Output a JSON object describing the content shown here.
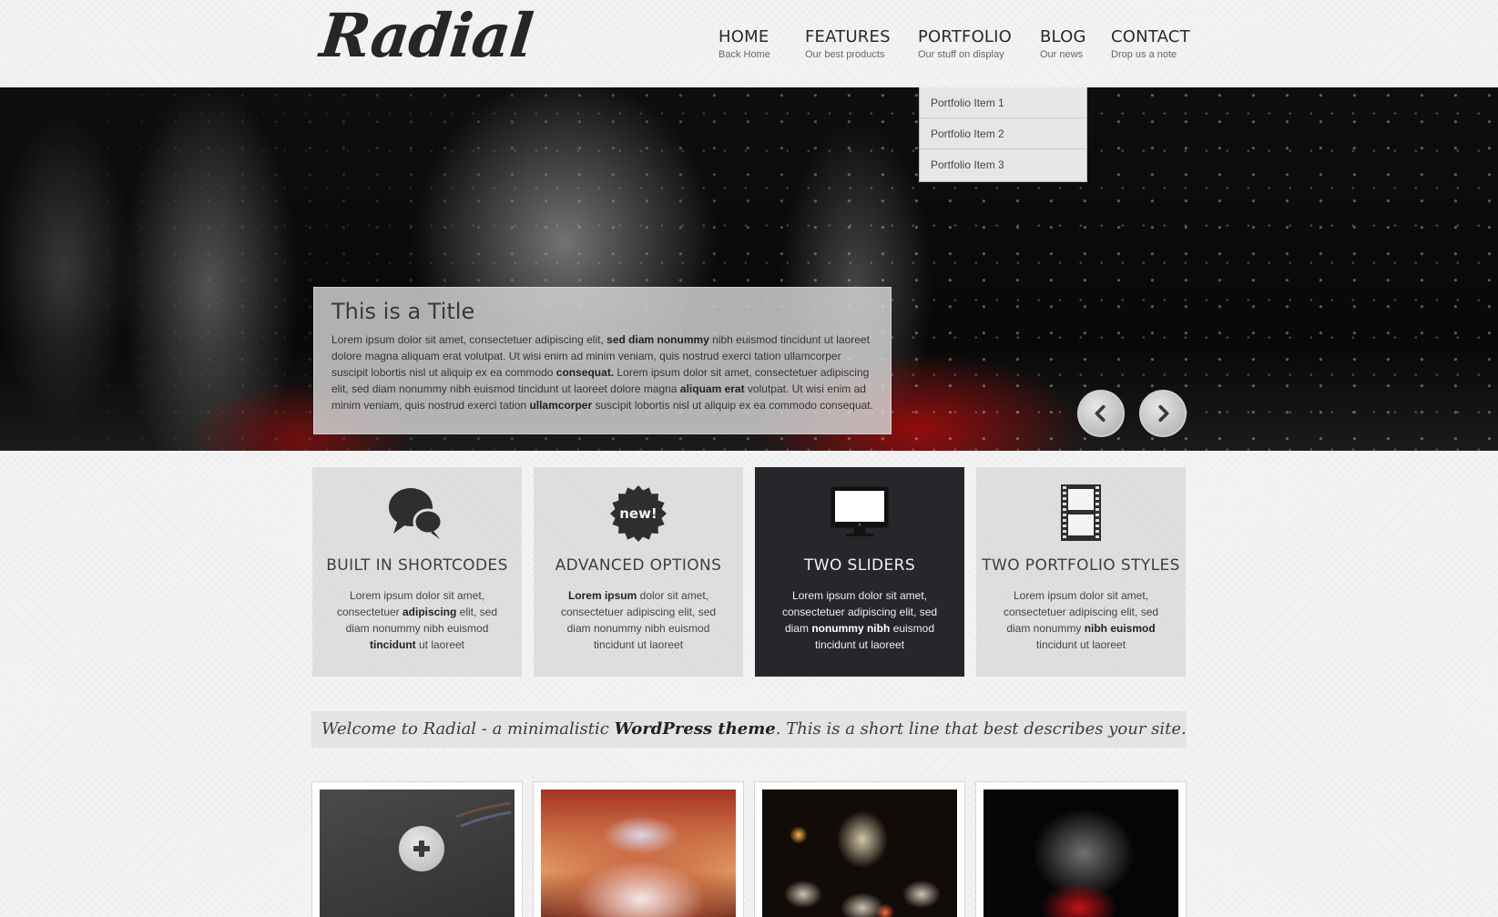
{
  "logo": "Radial",
  "nav": [
    {
      "title": "HOME",
      "subtitle": "Back Home"
    },
    {
      "title": "FEATURES",
      "subtitle": "Our best products"
    },
    {
      "title": "PORTFOLIO",
      "subtitle": "Our stuff on display"
    },
    {
      "title": "BLOG",
      "subtitle": "Our news"
    },
    {
      "title": "CONTACT",
      "subtitle": "Drop us a note"
    }
  ],
  "dropdown": [
    "Portfolio Item 1",
    "Portfolio Item 2",
    "Portfolio Item 3"
  ],
  "slider": {
    "title": "This is a Title",
    "text": [
      {
        "t": "Lorem ipsum dolor sit amet, consectetuer adipiscing elit, ",
        "b": false
      },
      {
        "t": "sed diam nonummy",
        "b": true
      },
      {
        "t": " nibh euismod tincidunt ut laoreet dolore magna aliquam erat volutpat. Ut wisi enim ad minim veniam, quis nostrud exerci tation ullamcorper suscipit lobortis nisl ut aliquip ex ea commodo ",
        "b": false
      },
      {
        "t": "consequat.",
        "b": true
      },
      {
        "t": " Lorem ipsum dolor sit amet, consectetuer adipiscing elit, sed diam nonummy nibh euismod tincidunt ut laoreet dolore magna ",
        "b": false
      },
      {
        "t": "aliquam erat",
        "b": true
      },
      {
        "t": " volutpat. Ut wisi enim ad minim veniam, quis nostrud exerci tation ",
        "b": false
      },
      {
        "t": "ullamcorper",
        "b": true
      },
      {
        "t": " suscipit lobortis nisl ut aliquip ex ea commodo consequat.",
        "b": false
      }
    ],
    "prev_icon": "chevron-left-icon",
    "next_icon": "chevron-right-icon"
  },
  "features": [
    {
      "icon": "speech-bubbles-icon",
      "title": "BUILT IN SHORTCODES",
      "text": [
        {
          "t": "Lorem ipsum dolor sit amet, consectetuer ",
          "b": false
        },
        {
          "t": "adipiscing",
          "b": true
        },
        {
          "t": " elit, sed diam nonummy nibh euismod ",
          "b": false
        },
        {
          "t": "tincidunt",
          "b": true
        },
        {
          "t": " ut laoreet",
          "b": false
        }
      ]
    },
    {
      "icon": "new-badge-icon",
      "badge_text": "new!",
      "title": "ADVANCED OPTIONS",
      "text": [
        {
          "t": "Lorem ipsum",
          "b": true
        },
        {
          "t": " dolor sit amet, consectetuer adipiscing elit, sed diam nonummy nibh euismod tincidunt ut laoreet",
          "b": false
        }
      ]
    },
    {
      "icon": "monitor-icon",
      "title": "TWO SLIDERS",
      "text": [
        {
          "t": "Lorem ipsum dolor sit amet, consectetuer adipiscing elit, sed diam ",
          "b": false
        },
        {
          "t": "nonummy nibh",
          "b": true
        },
        {
          "t": " euismod tincidunt ut laoreet",
          "b": false
        }
      ]
    },
    {
      "icon": "film-strip-icon",
      "title": "TWO PORTFOLIO STYLES",
      "text": [
        {
          "t": "Lorem ipsum dolor sit amet, consectetuer adipiscing elit, sed diam nonummy ",
          "b": false
        },
        {
          "t": "nibh euismod",
          "b": true
        },
        {
          "t": " tincidunt ut laoreet",
          "b": false
        }
      ]
    }
  ],
  "welcome": [
    {
      "t": "Welcome to Radial - a minimalistic ",
      "b": false
    },
    {
      "t": "WordPress theme",
      "b": true
    },
    {
      "t": ". This is a short line that best describes your site.",
      "b": false
    }
  ],
  "portfolio": [
    {
      "image": "pencils-photo",
      "overlay_icon": "plus-icon"
    },
    {
      "image": "cupcake-photo"
    },
    {
      "image": "skull-candles-photo"
    },
    {
      "image": "water-splash-photo"
    }
  ]
}
